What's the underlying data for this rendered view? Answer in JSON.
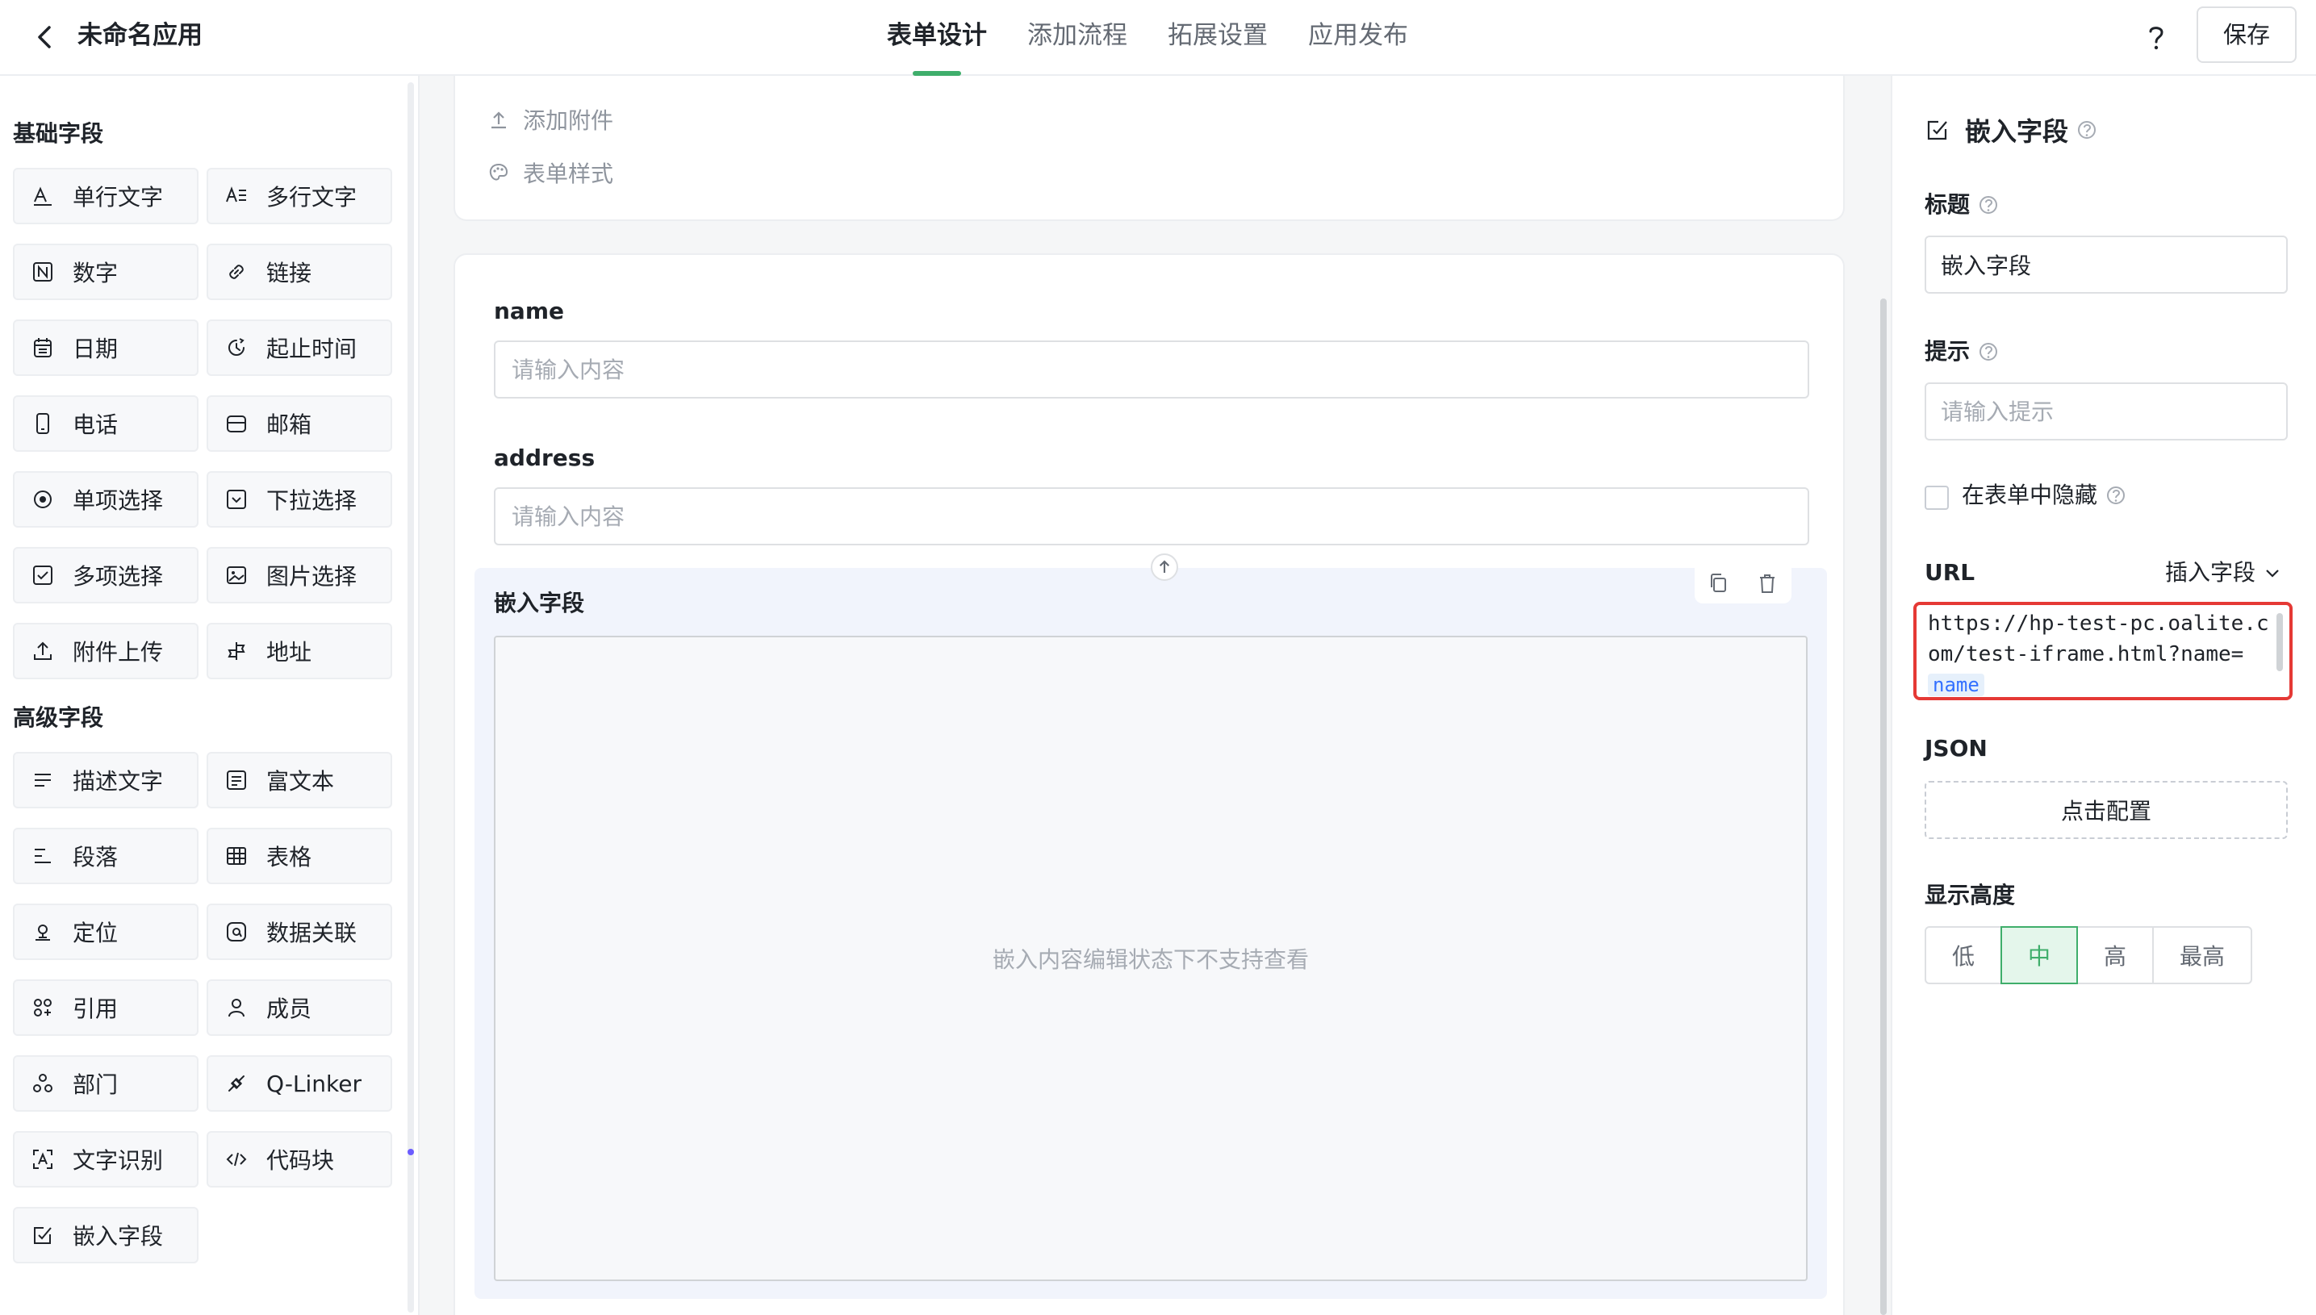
{
  "header": {
    "app_title": "未命名应用",
    "tabs": [
      "表单设计",
      "添加流程",
      "拓展设置",
      "应用发布"
    ],
    "active_tab": "表单设计",
    "save_label": "保存"
  },
  "left": {
    "basic_title": "基础字段",
    "advanced_title": "高级字段",
    "basic": [
      {
        "label": "单行文字",
        "icon": "single-line-text-icon"
      },
      {
        "label": "多行文字",
        "icon": "multi-line-text-icon"
      },
      {
        "label": "数字",
        "icon": "number-icon"
      },
      {
        "label": "链接",
        "icon": "link-icon"
      },
      {
        "label": "日期",
        "icon": "calendar-icon"
      },
      {
        "label": "起止时间",
        "icon": "time-range-icon"
      },
      {
        "label": "电话",
        "icon": "phone-icon"
      },
      {
        "label": "邮箱",
        "icon": "mailbox-icon"
      },
      {
        "label": "单项选择",
        "icon": "radio-icon"
      },
      {
        "label": "下拉选择",
        "icon": "dropdown-icon"
      },
      {
        "label": "多项选择",
        "icon": "checkbox-icon"
      },
      {
        "label": "图片选择",
        "icon": "image-icon"
      },
      {
        "label": "附件上传",
        "icon": "upload-icon"
      },
      {
        "label": "地址",
        "icon": "address-icon"
      }
    ],
    "advanced": [
      {
        "label": "描述文字",
        "icon": "description-icon"
      },
      {
        "label": "富文本",
        "icon": "rich-text-icon"
      },
      {
        "label": "段落",
        "icon": "paragraph-icon"
      },
      {
        "label": "表格",
        "icon": "table-icon"
      },
      {
        "label": "定位",
        "icon": "location-icon"
      },
      {
        "label": "数据关联",
        "icon": "data-link-icon"
      },
      {
        "label": "引用",
        "icon": "reference-icon"
      },
      {
        "label": "成员",
        "icon": "member-icon"
      },
      {
        "label": "部门",
        "icon": "department-icon"
      },
      {
        "label": "Q-Linker",
        "icon": "q-linker-icon"
      },
      {
        "label": "文字识别",
        "icon": "ocr-icon"
      },
      {
        "label": "代码块",
        "icon": "code-icon"
      },
      {
        "label": "嵌入字段",
        "icon": "embed-icon"
      }
    ]
  },
  "center": {
    "add_attachment": "添加附件",
    "form_style": "表单样式",
    "fields": [
      {
        "label": "name",
        "placeholder": "请输入内容"
      },
      {
        "label": "address",
        "placeholder": "请输入内容"
      }
    ],
    "embed_label": "嵌入字段",
    "embed_message": "嵌入内容编辑状态下不支持查看"
  },
  "right": {
    "panel_title": "嵌入字段",
    "title_label": "标题",
    "title_value": "嵌入字段",
    "hint_label": "提示",
    "hint_placeholder": "请输入提示",
    "hide_label": "在表单中隐藏",
    "url_label": "URL",
    "insert_field_label": "插入字段",
    "url_text": "https://hp-test-pc.oalite.com/test-iframe.html?name=",
    "url_tag": "name",
    "json_label": "JSON",
    "json_button": "点击配置",
    "height_label": "显示高度",
    "height_options": [
      "低",
      "中",
      "高",
      "最高"
    ],
    "height_selected": "中"
  },
  "colors": {
    "accent": "#3fae6b",
    "highlight_border": "#e53935",
    "tag_text": "#3370ff"
  }
}
